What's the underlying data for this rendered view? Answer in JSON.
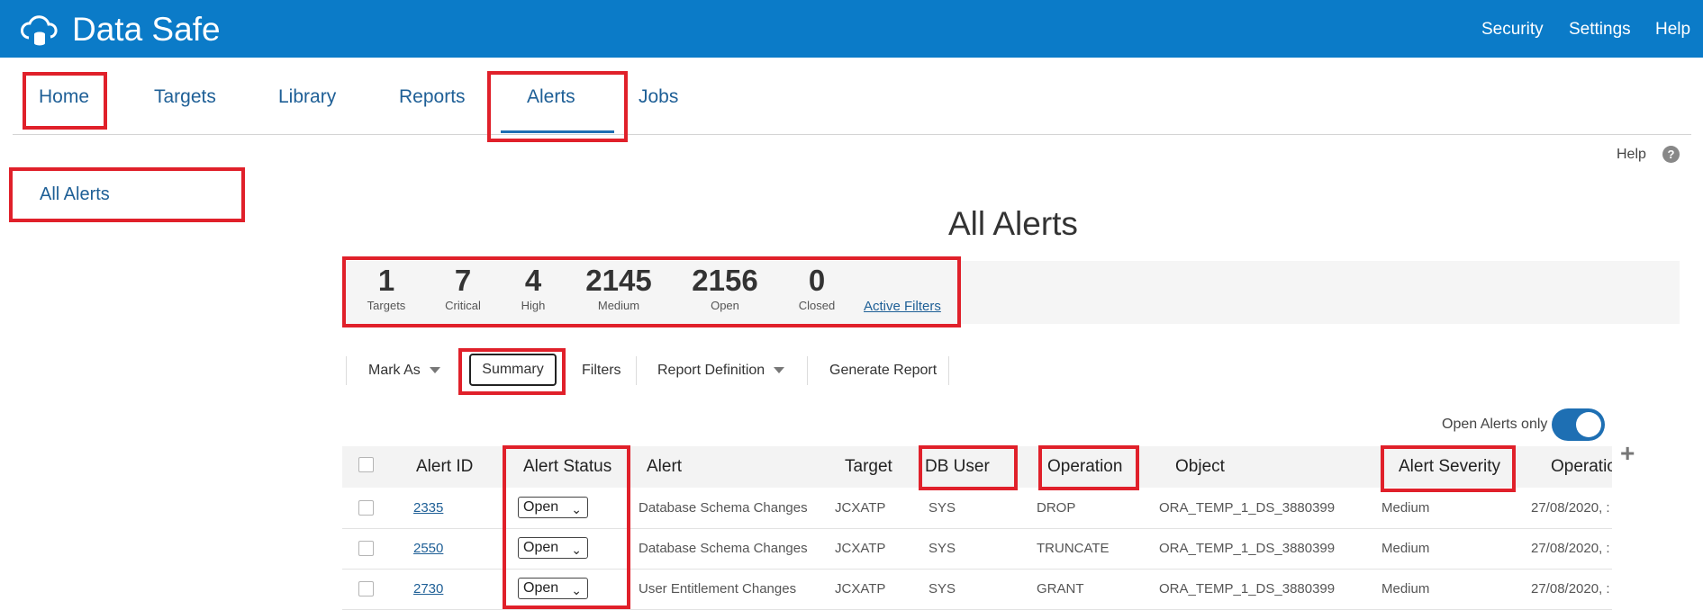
{
  "app": {
    "title": "Data Safe",
    "logo_icon": "cloud-database-icon"
  },
  "top_nav": [
    "Security",
    "Settings",
    "Help"
  ],
  "main_nav": {
    "tabs": [
      "Home",
      "Targets",
      "Library",
      "Reports",
      "Alerts",
      "Jobs"
    ],
    "active": "Alerts"
  },
  "help": {
    "label": "Help",
    "icon": "?"
  },
  "sidebar": {
    "items": [
      "All Alerts"
    ]
  },
  "page_title": "All Alerts",
  "summary": {
    "stats": [
      {
        "value": "1",
        "label": "Targets"
      },
      {
        "value": "7",
        "label": "Critical"
      },
      {
        "value": "4",
        "label": "High"
      },
      {
        "value": "2145",
        "label": "Medium"
      },
      {
        "value": "2156",
        "label": "Open"
      },
      {
        "value": "0",
        "label": "Closed"
      }
    ],
    "active_filters": "Active Filters"
  },
  "toolbar": {
    "mark_as": "Mark As",
    "summary": "Summary",
    "filters": "Filters",
    "report_definition": "Report Definition",
    "generate_report": "Generate Report"
  },
  "toggle": {
    "label": "Open Alerts only",
    "on": true
  },
  "table": {
    "headers": [
      "Alert ID",
      "Alert Status",
      "Alert",
      "Target",
      "DB User",
      "Operation",
      "Object",
      "Alert Severity",
      "Operatio"
    ],
    "rows": [
      {
        "id": "2335",
        "status": "Open",
        "alert": "Database Schema Changes",
        "target": "JCXATP",
        "db_user": "SYS",
        "operation": "DROP",
        "object": "ORA_TEMP_1_DS_3880399",
        "severity": "Medium",
        "op_time": "27/08/2020, :"
      },
      {
        "id": "2550",
        "status": "Open",
        "alert": "Database Schema Changes",
        "target": "JCXATP",
        "db_user": "SYS",
        "operation": "TRUNCATE",
        "object": "ORA_TEMP_1_DS_3880399",
        "severity": "Medium",
        "op_time": "27/08/2020, :"
      },
      {
        "id": "2730",
        "status": "Open",
        "alert": "User Entitlement Changes",
        "target": "JCXATP",
        "db_user": "SYS",
        "operation": "GRANT",
        "object": "ORA_TEMP_1_DS_3880399",
        "severity": "Medium",
        "op_time": "27/08/2020, :"
      }
    ]
  },
  "colors": {
    "header_blue": "#0b7bc8",
    "highlight_red": "#e0202a",
    "link_blue": "#1e5f96"
  }
}
